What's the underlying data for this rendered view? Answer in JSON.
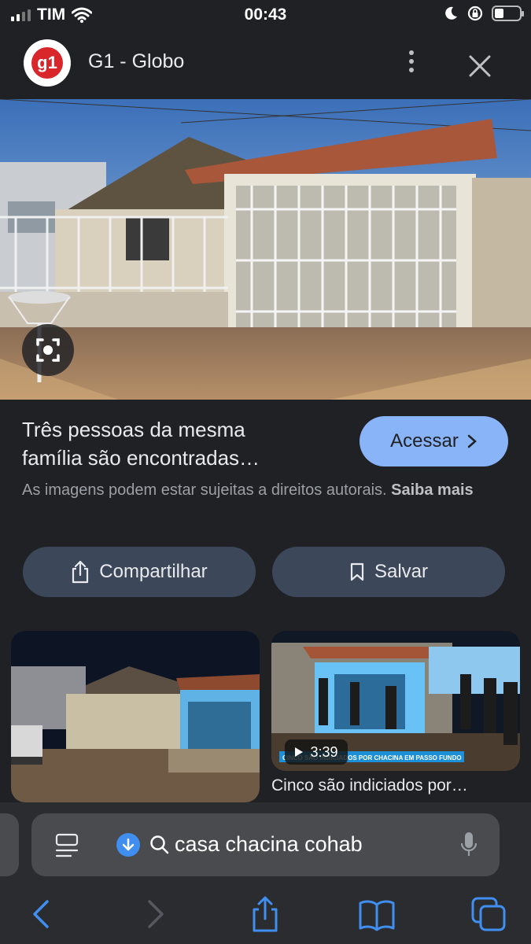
{
  "status_bar": {
    "carrier": "TIM",
    "time": "00:43"
  },
  "header": {
    "logo_text": "g1",
    "source_name": "G1 - Globo",
    "more_icon": "more-vertical-icon",
    "close_icon": "close-icon"
  },
  "result": {
    "title_line1": "Três pessoas da mesma",
    "title_line2": "família são encontradas…",
    "visit_label": "Acessar",
    "copyright_text": "As imagens podem estar sujeitas a direitos autorais.",
    "learn_more": "Saiba mais"
  },
  "actions": {
    "share_label": "Compartilhar",
    "save_label": "Salvar"
  },
  "related": {
    "video_duration": "3:39",
    "video_banner": "CINCO SÃO INDICIADOS POR CHACINA EM PASSO FUNDO",
    "video_caption": "Cinco são indiciados por…"
  },
  "search": {
    "query": "casa chacina cohab"
  },
  "colors": {
    "background": "#202124",
    "accent": "#8ab4f8",
    "pill": "#3c4759",
    "logo_red": "#d8262a",
    "safari_blue": "#3f8ef0"
  }
}
